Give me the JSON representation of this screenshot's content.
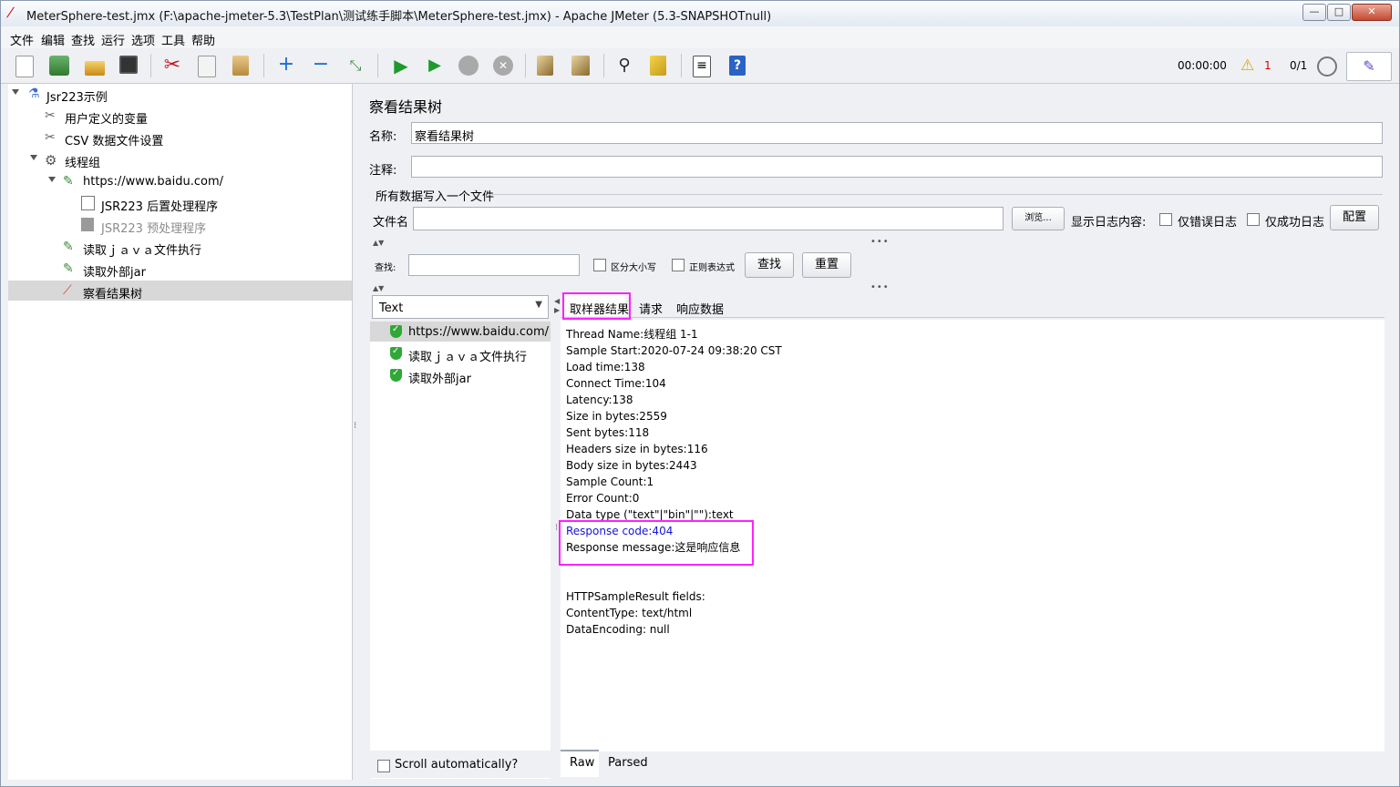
{
  "window": {
    "title": "MeterSphere-test.jmx (F:\\apache-jmeter-5.3\\TestPlan\\测试练手脚本\\MeterSphere-test.jmx) - Apache JMeter (5.3-SNAPSHOTnull)",
    "min": "—",
    "max": "□",
    "close": "✕"
  },
  "menu": [
    "文件",
    "编辑",
    "查找",
    "运行",
    "选项",
    "工具",
    "帮助"
  ],
  "toolbar": {
    "timer": "00:00:00",
    "warnings": "1",
    "threads": "0/1",
    "icons": [
      "new-icon",
      "templates-icon",
      "open-icon",
      "save-icon",
      "cut-icon",
      "copy-icon",
      "paste-icon",
      "expand-icon",
      "collapse-icon",
      "toggle-icon",
      "start-icon",
      "start-no-pause-icon",
      "stop-icon",
      "shutdown-icon",
      "clear-icon",
      "clear-all-icon",
      "search-icon",
      "reset-search-icon",
      "function-helper-icon",
      "help-icon"
    ]
  },
  "tree": {
    "root": "Jsr223示例",
    "items": [
      {
        "label": "用户定义的变量",
        "icon": "wrench-icon"
      },
      {
        "label": "CSV 数据文件设置",
        "icon": "wrench-icon"
      },
      {
        "label": "线程组",
        "icon": "gear-icon"
      },
      {
        "label": "https://www.baidu.com/",
        "icon": "pipette-icon"
      },
      {
        "label": "JSR223 后置处理程序",
        "icon": "post-processor-icon"
      },
      {
        "label": "JSR223 预处理程序",
        "icon": "pre-processor-icon"
      },
      {
        "label": "读取ｊａｖａ文件执行",
        "icon": "pipette-icon"
      },
      {
        "label": "读取外部jar",
        "icon": "pipette-icon"
      },
      {
        "label": "察看结果树",
        "icon": "chart-icon"
      }
    ]
  },
  "panel": {
    "title": "察看结果树",
    "name_label": "名称:",
    "name_value": "察看结果树",
    "comment_label": "注释:",
    "comment_value": "",
    "file_group": "所有数据写入一个文件",
    "filename_label": "文件名",
    "filename_value": "",
    "browse": "浏览...",
    "log_label": "显示日志内容:",
    "errors_only": "仅错误日志",
    "success_only": "仅成功日志",
    "configure": "配置",
    "search_label": "查找:",
    "search_value": "",
    "case_sensitive": "区分大小写",
    "regex": "正则表达式",
    "find_btn": "查找",
    "reset_btn": "重置"
  },
  "results": {
    "renderer": "Text",
    "items": [
      "https://www.baidu.com/",
      "读取ｊａｖａ文件执行",
      "读取外部jar"
    ],
    "scroll_auto": "Scroll automatically?"
  },
  "tabs": [
    "取样器结果",
    "请求",
    "响应数据"
  ],
  "sample": {
    "lines": [
      "Thread Name:线程组 1-1",
      "Sample Start:2020-07-24 09:38:20 CST",
      "Load time:138",
      "Connect Time:104",
      "Latency:138",
      "Size in bytes:2559",
      "Sent bytes:118",
      "Headers size in bytes:116",
      "Body size in bytes:2443",
      "Sample Count:1",
      "Error Count:0",
      "Data type (\"text\"|\"bin\"|\"\"):text",
      "Response code:404",
      "Response message:这是响应信息",
      "",
      "",
      "HTTPSampleResult fields:",
      "ContentType: text/html",
      "DataEncoding: null"
    ],
    "response_code_color": "#1515d8",
    "highlight_color": "#ff20ff"
  },
  "bottom_tabs": [
    "Raw",
    "Parsed"
  ]
}
